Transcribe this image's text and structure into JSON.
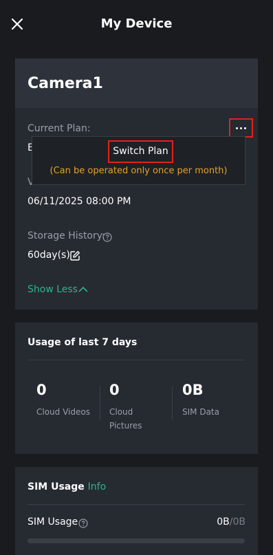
{
  "header": {
    "title": "My Device",
    "close_icon": "close-icon"
  },
  "device": {
    "name": "Camera1",
    "current_plan_label": "Current Plan:",
    "current_plan_value_partial": "E",
    "valid_until_label_partial": "Valid Until:",
    "valid_until_value": "06/11/2025 08:00 PM",
    "storage_history_label": "Storage History:",
    "storage_history_value": "60day(s)",
    "show_less": "Show Less",
    "more_icon": "more-horizontal-icon"
  },
  "popover": {
    "switch_plan": "Switch Plan",
    "note": "(Can be operated only once per month)"
  },
  "usage": {
    "title": "Usage of last 7 days",
    "stats": [
      {
        "value": "0",
        "label": "Cloud Videos"
      },
      {
        "value": "0",
        "label": "Cloud Pictures"
      },
      {
        "value": "0B",
        "label": "SIM Data"
      }
    ]
  },
  "sim": {
    "title": "SIM Usage",
    "info_link": "Info",
    "usage_label": "SIM Usage",
    "used": "0B",
    "separator": "/",
    "total": "0B",
    "progress_fraction": 0
  },
  "colors": {
    "background": "#1a1b1f",
    "card": "#262a31",
    "card_header": "#2e333b",
    "accent_green": "#2fb48c",
    "warning_orange": "#e6a128",
    "highlight_red": "#e0241c"
  }
}
